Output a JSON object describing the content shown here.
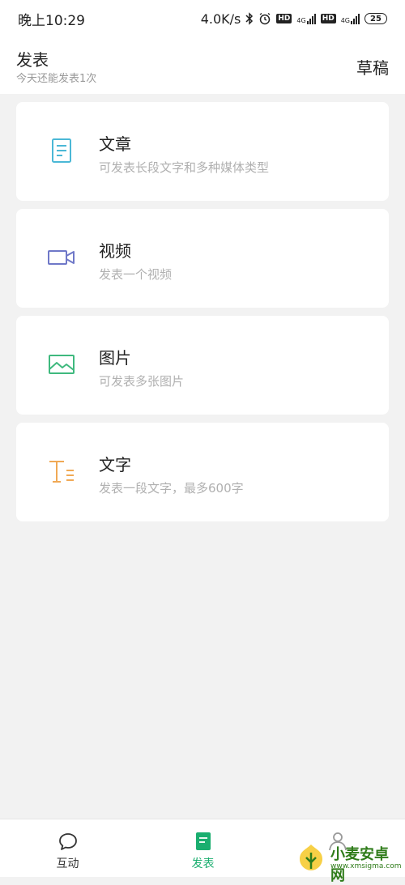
{
  "status_bar": {
    "time": "晚上10:29",
    "net_speed": "4.0K/s",
    "icons": [
      "bluetooth-icon",
      "alarm-icon",
      "hd-icon",
      "signal-4g-icon",
      "hd-icon",
      "signal-4g-icon",
      "battery-icon"
    ],
    "hd": "HD",
    "network": "4G",
    "battery": "25"
  },
  "header": {
    "title": "发表",
    "subtitle": "今天还能发表1次",
    "drafts_label": "草稿"
  },
  "options": [
    {
      "title": "文章",
      "desc": "可发表长段文字和多种媒体类型",
      "icon": "article-icon",
      "color": "#4bb8d6"
    },
    {
      "title": "视频",
      "desc": "发表一个视频",
      "icon": "video-icon",
      "color": "#6f78c8"
    },
    {
      "title": "图片",
      "desc": "可发表多张图片",
      "icon": "image-icon",
      "color": "#3fb97e"
    },
    {
      "title": "文字",
      "desc": "发表一段文字，最多600字",
      "icon": "text-icon",
      "color": "#f0a955"
    }
  ],
  "tabs": [
    {
      "label": "互动",
      "icon": "chat-bubble-icon",
      "active": false
    },
    {
      "label": "发表",
      "icon": "publish-doc-icon",
      "active": true
    },
    {
      "label": "",
      "icon": "profile-icon",
      "active": false
    }
  ],
  "watermark": {
    "text": "小麦安卓网",
    "url": "www.xmsigma.com"
  },
  "colors": {
    "accent": "#1aae6f",
    "background": "#f2f2f2"
  }
}
